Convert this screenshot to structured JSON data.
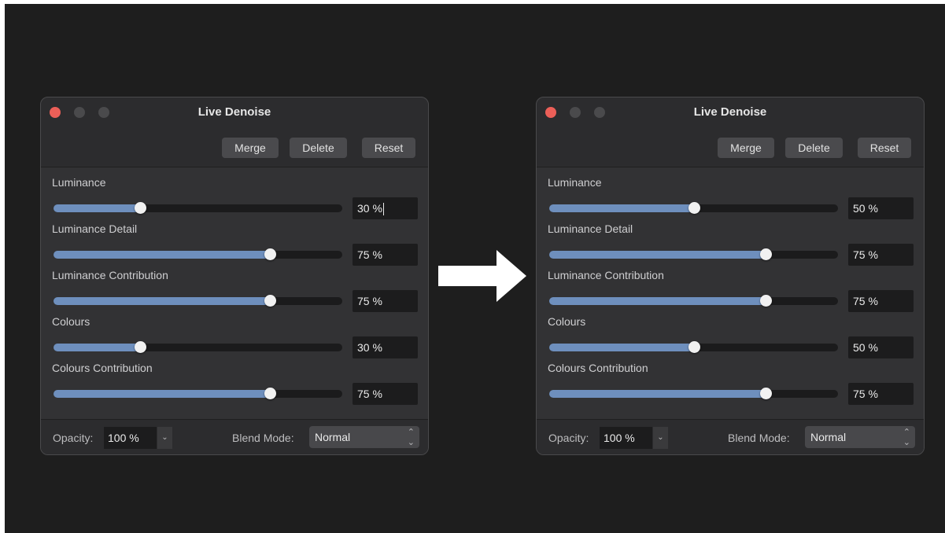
{
  "panels": [
    {
      "title": "Live Denoise",
      "buttons": {
        "merge": "Merge",
        "delete": "Delete",
        "reset": "Reset"
      },
      "sliders": [
        {
          "label": "Luminance",
          "value": 30,
          "display": "30 %",
          "editing": true
        },
        {
          "label": "Luminance Detail",
          "value": 75,
          "display": "75 %"
        },
        {
          "label": "Luminance Contribution",
          "value": 75,
          "display": "75 %"
        },
        {
          "label": "Colours",
          "value": 30,
          "display": "30 %"
        },
        {
          "label": "Colours Contribution",
          "value": 75,
          "display": "75 %"
        }
      ],
      "footer": {
        "opacity_label": "Opacity:",
        "opacity_value": "100 %",
        "blend_label": "Blend Mode:",
        "blend_value": "Normal"
      }
    },
    {
      "title": "Live Denoise",
      "buttons": {
        "merge": "Merge",
        "delete": "Delete",
        "reset": "Reset"
      },
      "sliders": [
        {
          "label": "Luminance",
          "value": 50,
          "display": "50 %"
        },
        {
          "label": "Luminance Detail",
          "value": 75,
          "display": "75 %"
        },
        {
          "label": "Luminance Contribution",
          "value": 75,
          "display": "75 %"
        },
        {
          "label": "Colours",
          "value": 50,
          "display": "50 %"
        },
        {
          "label": "Colours Contribution",
          "value": 75,
          "display": "75 %"
        }
      ],
      "footer": {
        "opacity_label": "Opacity:",
        "opacity_value": "100 %",
        "blend_label": "Blend Mode:",
        "blend_value": "Normal"
      }
    }
  ],
  "icons": {
    "traffic_lights": [
      "close-button",
      "minimize-button",
      "zoom-button"
    ],
    "arrow": "right-arrow-icon",
    "opacity_dropdown": "chevron-down-icon",
    "blend_dropdown": "up-down-chevron-icon"
  },
  "colors": {
    "background": "#1e1e1e",
    "panel": "#2c2c2e",
    "slider_fill": "#6e8fbd",
    "close": "#ec5f58"
  }
}
